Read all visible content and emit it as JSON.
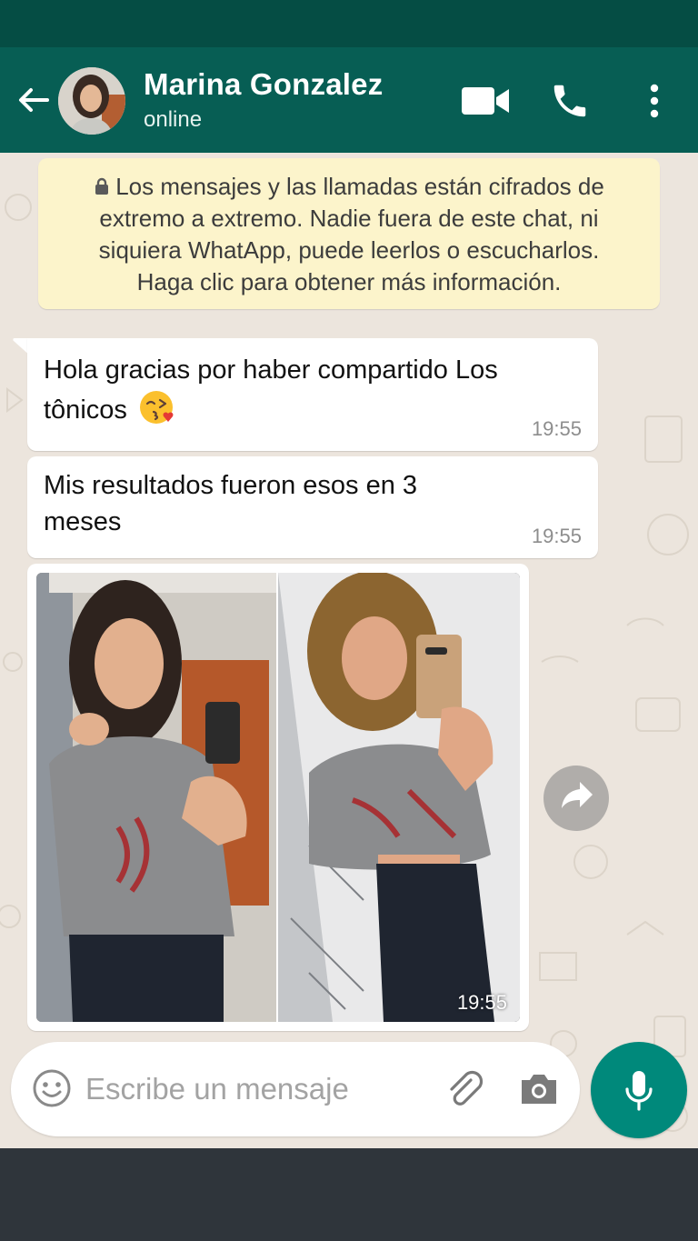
{
  "header": {
    "contact_name": "Marina Gonzalez",
    "status": "online",
    "back_icon": "arrow-left-icon",
    "video_icon": "videocam-icon",
    "call_icon": "phone-icon",
    "menu_icon": "more-vert-icon"
  },
  "encryption_notice": {
    "icon": "lock-icon",
    "lines": [
      "Los mensajes y las llamadas están cifrados de",
      "extremo a extremo. Nadie fuera de este chat, ni",
      "siquiera WhatApp, puede leerlos o escucharlos.",
      "Haga clic para obtener más información."
    ]
  },
  "messages": [
    {
      "text_line1": "Hola gracias por haber compartido Los",
      "text_line2": "tônicos",
      "emoji": "face-blowing-kiss",
      "time": "19:55"
    },
    {
      "text_line1": "Mis resultados fueron esos en 3",
      "text_line2": "meses",
      "time": "19:55"
    },
    {
      "type": "image",
      "description": "before-after-photo",
      "time": "19:55"
    }
  ],
  "forward_icon": "share-forward-icon",
  "composer": {
    "placeholder": "Escribe un mensaje",
    "emoji_icon": "smiley-icon",
    "attach_icon": "paperclip-icon",
    "camera_icon": "camera-icon",
    "mic_icon": "microphone-icon"
  },
  "colors": {
    "header": "#075E54",
    "status_bar": "#054D44",
    "chat_bg": "#ECE5DD",
    "notice_bg": "#FCF4CB",
    "mic_button": "#00897B",
    "nav_bar": "#2f353b"
  }
}
